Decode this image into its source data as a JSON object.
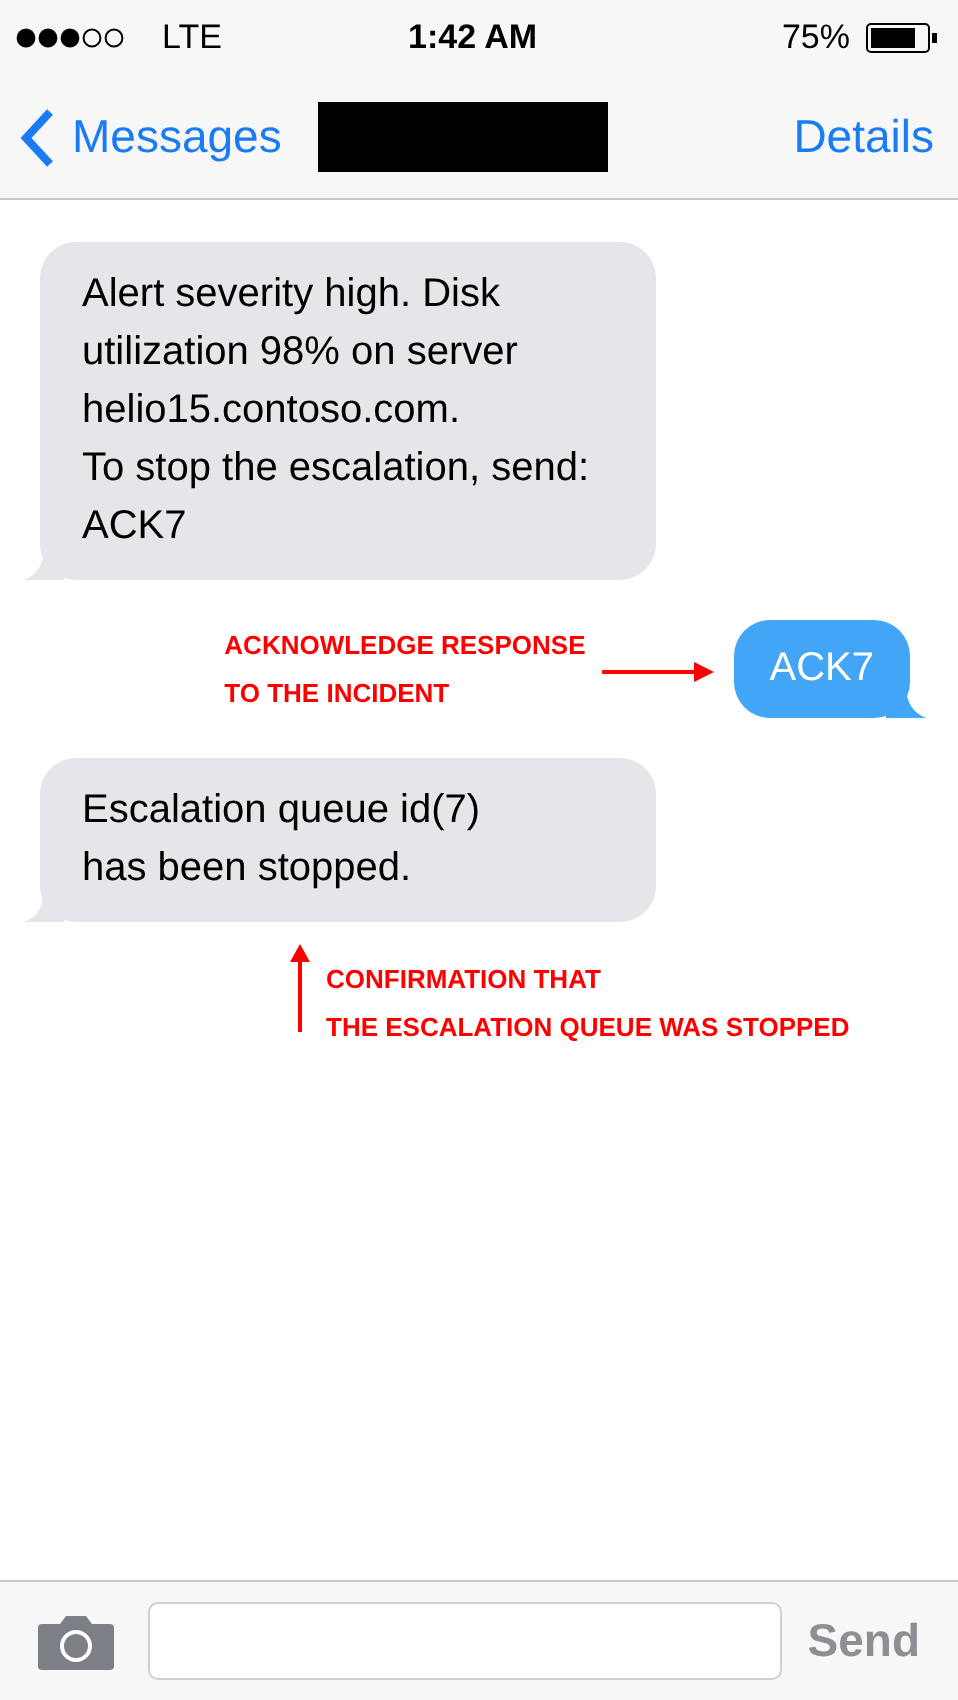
{
  "status_bar": {
    "carrier": "LTE",
    "time": "1:42 AM",
    "battery": "75%"
  },
  "nav": {
    "back": "Messages",
    "action": "Details"
  },
  "messages": [
    {
      "kind": "incoming",
      "text": "Alert severity high. Disk utilization 98% on server helio15.contoso.com.\nTo stop the escalation, send: ACK7"
    },
    {
      "kind": "outgoing",
      "text": "ACK7",
      "annotation": "ACKNOWLEDGE RESPONSE\nTO THE INCIDENT"
    },
    {
      "kind": "incoming",
      "text": "Escalation queue id(7)\nhas been stopped.",
      "annotation": "CONFIRMATION THAT\nTHE ESCALATION QUEUE WAS STOPPED"
    }
  ],
  "composer": {
    "send": "Send"
  }
}
